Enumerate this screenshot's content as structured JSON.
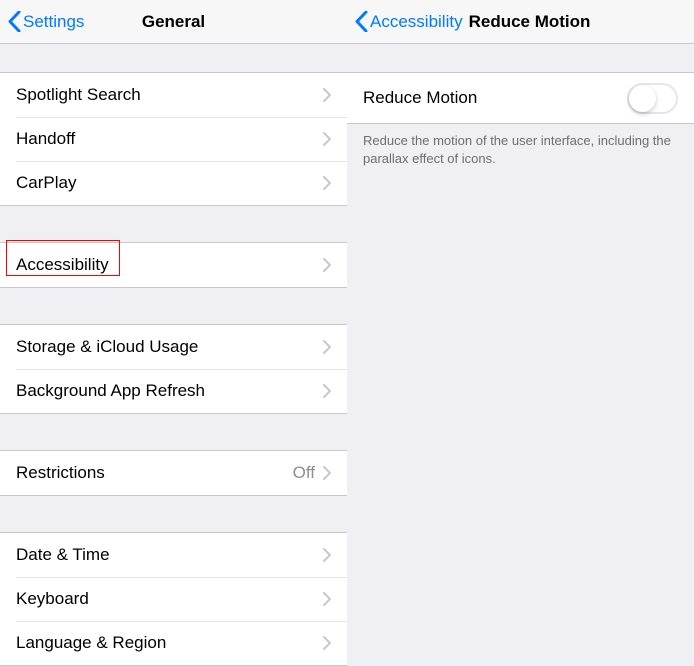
{
  "leftPane": {
    "back": {
      "label": "Settings"
    },
    "title": "General",
    "groups": {
      "g1": [
        {
          "label": "Spotlight Search"
        },
        {
          "label": "Handoff"
        },
        {
          "label": "CarPlay"
        }
      ],
      "g2": [
        {
          "label": "Accessibility"
        }
      ],
      "g3": [
        {
          "label": "Storage & iCloud Usage"
        },
        {
          "label": "Background App Refresh"
        }
      ],
      "g4": [
        {
          "label": "Restrictions",
          "value": "Off"
        }
      ],
      "g5": [
        {
          "label": "Date & Time"
        },
        {
          "label": "Keyboard"
        },
        {
          "label": "Language & Region"
        }
      ]
    }
  },
  "rightPane": {
    "back": {
      "label": "Accessibility"
    },
    "title": "Reduce Motion",
    "row": {
      "label": "Reduce Motion"
    },
    "footer": "Reduce the motion of the user interface, including the parallax effect of icons."
  }
}
